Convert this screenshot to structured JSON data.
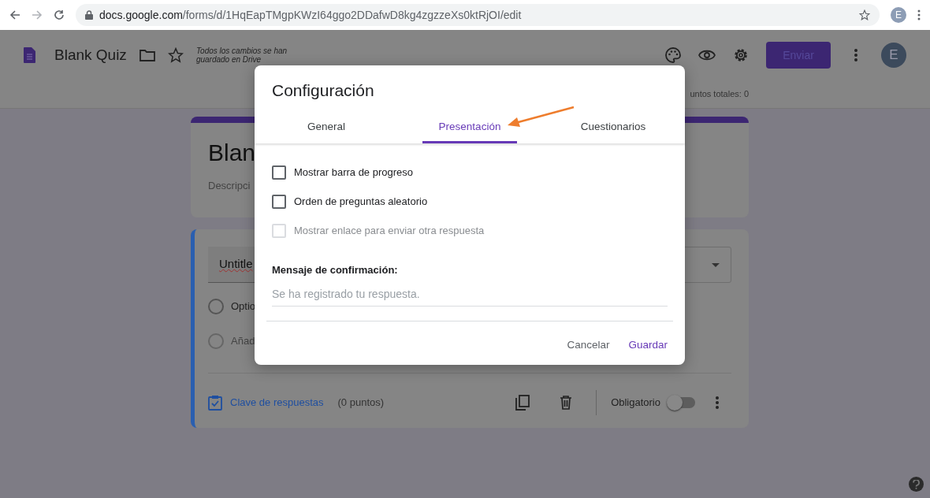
{
  "browser": {
    "url_host": "docs.google.com",
    "url_path": "/forms/d/1HqEapTMgpKWzI64ggo2DDafwD8kg4zgzzeXs0ktRjOI/edit",
    "avatar_letter": "E"
  },
  "header": {
    "title": "Blank Quiz",
    "save_status": "Todos los cambios se han guardado en Drive",
    "send_button": "Enviar",
    "avatar_letter": "E"
  },
  "subheader": {
    "points_text": "untos totales: 0"
  },
  "form_header": {
    "title": "Blan",
    "description": "Descripci"
  },
  "question": {
    "title": "Untitle",
    "options": [
      {
        "label": "Optio",
        "kind": "option"
      },
      {
        "label": "Añad",
        "kind": "add"
      }
    ],
    "answer_key_link": "Clave de respuestas",
    "points": "(0 puntos)",
    "required_label": "Obligatorio",
    "required": false
  },
  "dialog": {
    "title": "Configuración",
    "tabs": [
      {
        "label": "General",
        "selected": false
      },
      {
        "label": "Presentación",
        "selected": true
      },
      {
        "label": "Cuestionarios",
        "selected": false
      }
    ],
    "options": [
      {
        "label": "Mostrar barra de progreso",
        "checked": false,
        "disabled": false
      },
      {
        "label": "Orden de preguntas aleatorio",
        "checked": false,
        "disabled": false
      },
      {
        "label": "Mostrar enlace para enviar otra respuesta",
        "checked": false,
        "disabled": true
      }
    ],
    "confirmation_label": "Mensaje de confirmación:",
    "confirmation_placeholder": "Se ha registrado tu respuesta.",
    "buttons": [
      {
        "label": "Cancelar",
        "kind": "secondary"
      },
      {
        "label": "Guardar",
        "kind": "primary"
      }
    ]
  }
}
